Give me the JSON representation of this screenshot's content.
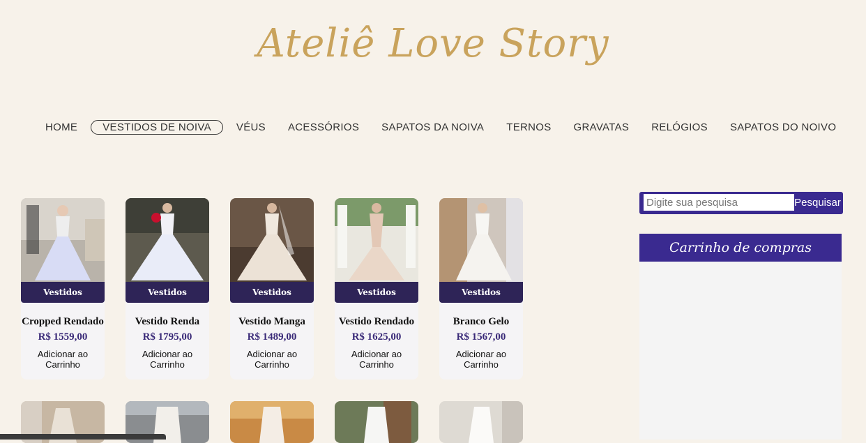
{
  "brand": {
    "logo": "Ateliê Love Story",
    "accent": "#c9a35c",
    "primary": "#3a2a90"
  },
  "nav": [
    {
      "label": "HOME",
      "active": false
    },
    {
      "label": "VESTIDOS DE NOIVA",
      "active": true
    },
    {
      "label": "VÉUS",
      "active": false
    },
    {
      "label": "ACESSÓRIOS",
      "active": false
    },
    {
      "label": "SAPATOS DA NOIVA",
      "active": false
    },
    {
      "label": "TERNOS",
      "active": false
    },
    {
      "label": "GRAVATAS",
      "active": false
    },
    {
      "label": "RELÓGIOS",
      "active": false
    },
    {
      "label": "SAPATOS DO NOIVO",
      "active": false
    }
  ],
  "products": [
    {
      "category": "Vestidos",
      "name": "Cropped Rendado",
      "price": "R$ 1559,00",
      "action": "Adicionar ao Carrinho"
    },
    {
      "category": "Vestidos",
      "name": "Vestido Renda",
      "price": "R$ 1795,00",
      "action": "Adicionar ao Carrinho"
    },
    {
      "category": "Vestidos",
      "name": "Vestido Manga",
      "price": "R$ 1489,00",
      "action": "Adicionar ao Carrinho"
    },
    {
      "category": "Vestidos",
      "name": "Vestido Rendado",
      "price": "R$ 1625,00",
      "action": "Adicionar ao Carrinho"
    },
    {
      "category": "Vestidos",
      "name": "Branco Gelo",
      "price": "R$ 1567,00",
      "action": "Adicionar ao Carrinho"
    }
  ],
  "search": {
    "placeholder": "Digite sua pesquisa",
    "button": "Pesquisar"
  },
  "cart": {
    "title": "Carrinho de compras"
  }
}
